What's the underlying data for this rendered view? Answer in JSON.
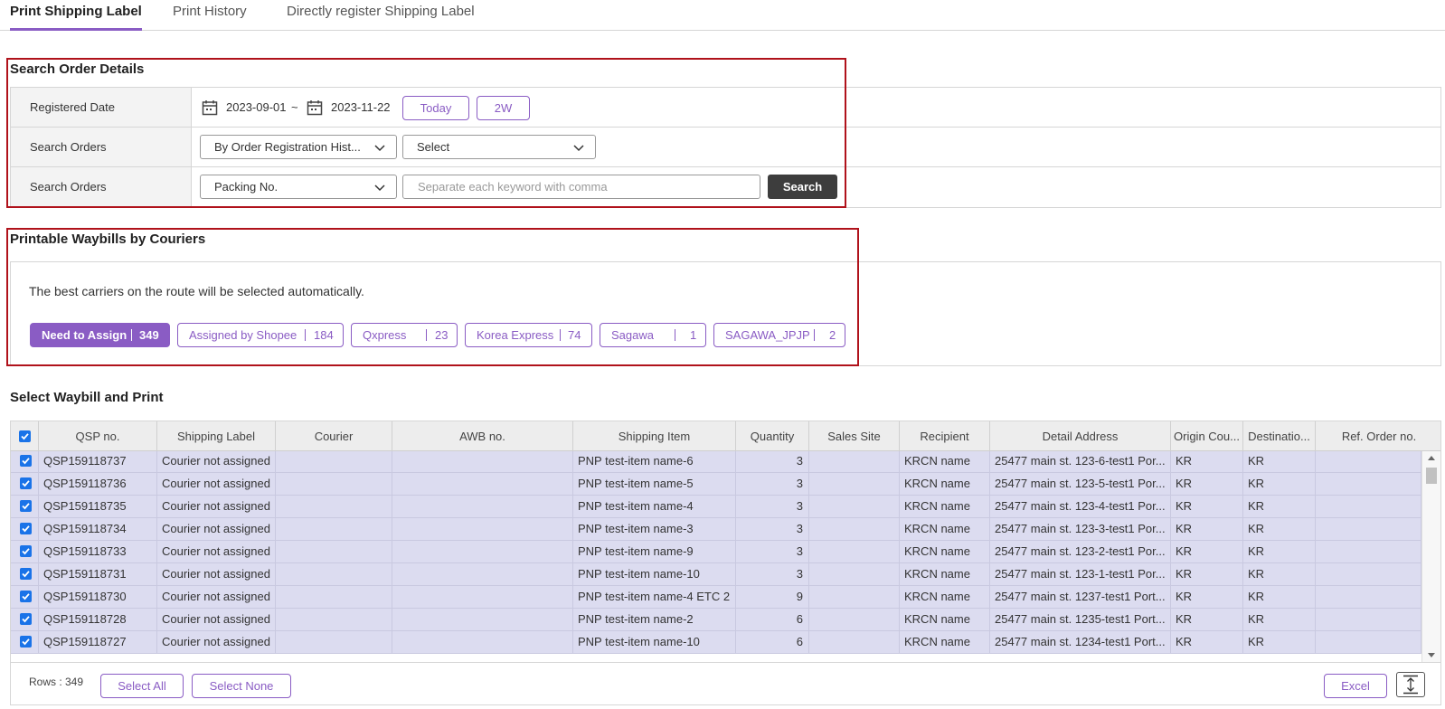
{
  "tabs": [
    {
      "label": "Print Shipping Label",
      "active": true
    },
    {
      "label": "Print History",
      "active": false
    },
    {
      "label": "Directly register Shipping Label",
      "active": false
    }
  ],
  "search": {
    "title": "Search Order Details",
    "registered_date_label": "Registered Date",
    "date_from": "2023-09-01",
    "date_sep": "~",
    "date_to": "2023-11-22",
    "today_button": "Today",
    "two_week_button": "2W",
    "search_orders_label_1": "Search Orders",
    "order_type_select": "By Order Registration Hist...",
    "order_sub_select": "Select",
    "search_orders_label_2": "Search Orders",
    "keyword_type_select": "Packing No.",
    "keyword_placeholder": "Separate each keyword with comma",
    "search_button": "Search"
  },
  "waybills": {
    "title": "Printable Waybills by Couriers",
    "note": "The best carriers on the route will be selected automatically.",
    "chips": [
      {
        "name": "Need to Assign",
        "count": "349",
        "active": true
      },
      {
        "name": "Assigned by Shopee",
        "count": "184",
        "active": false
      },
      {
        "name": "Qxpress",
        "count": "23",
        "active": false
      },
      {
        "name": "Korea Express",
        "count": "74",
        "active": false
      },
      {
        "name": "Sagawa",
        "count": "1",
        "active": false
      },
      {
        "name": "SAGAWA_JPJP",
        "count": "2",
        "active": false
      }
    ]
  },
  "grid": {
    "title": "Select Waybill and Print",
    "columns": [
      "QSP no.",
      "Shipping Label",
      "Courier",
      "AWB no.",
      "Shipping Item",
      "Quantity",
      "Sales Site",
      "Recipient",
      "Detail Address",
      "Origin Cou...",
      "Destinatio...",
      "Ref. Order no."
    ],
    "rows": [
      {
        "qsp": "QSP159118737",
        "label": "Courier not assigned",
        "courier": "",
        "awb": "",
        "item": "PNP test-item name-6",
        "qty": "3",
        "site": "",
        "recipient": "KRCN name",
        "address": "25477 main st. 123-6-test1 Por...",
        "origin": "KR",
        "dest": "KR",
        "ref": ""
      },
      {
        "qsp": "QSP159118736",
        "label": "Courier not assigned",
        "courier": "",
        "awb": "",
        "item": "PNP test-item name-5",
        "qty": "3",
        "site": "",
        "recipient": "KRCN name",
        "address": "25477 main st. 123-5-test1 Por...",
        "origin": "KR",
        "dest": "KR",
        "ref": ""
      },
      {
        "qsp": "QSP159118735",
        "label": "Courier not assigned",
        "courier": "",
        "awb": "",
        "item": "PNP test-item name-4",
        "qty": "3",
        "site": "",
        "recipient": "KRCN name",
        "address": "25477 main st. 123-4-test1 Por...",
        "origin": "KR",
        "dest": "KR",
        "ref": ""
      },
      {
        "qsp": "QSP159118734",
        "label": "Courier not assigned",
        "courier": "",
        "awb": "",
        "item": "PNP test-item name-3",
        "qty": "3",
        "site": "",
        "recipient": "KRCN name",
        "address": "25477 main st. 123-3-test1 Por...",
        "origin": "KR",
        "dest": "KR",
        "ref": ""
      },
      {
        "qsp": "QSP159118733",
        "label": "Courier not assigned",
        "courier": "",
        "awb": "",
        "item": "PNP test-item name-9",
        "qty": "3",
        "site": "",
        "recipient": "KRCN name",
        "address": "25477 main st. 123-2-test1 Por...",
        "origin": "KR",
        "dest": "KR",
        "ref": ""
      },
      {
        "qsp": "QSP159118731",
        "label": "Courier not assigned",
        "courier": "",
        "awb": "",
        "item": "PNP test-item name-10",
        "qty": "3",
        "site": "",
        "recipient": "KRCN name",
        "address": "25477 main st. 123-1-test1 Por...",
        "origin": "KR",
        "dest": "KR",
        "ref": ""
      },
      {
        "qsp": "QSP159118730",
        "label": "Courier not assigned",
        "courier": "",
        "awb": "",
        "item": "PNP test-item name-4 ETC 2",
        "qty": "9",
        "site": "",
        "recipient": "KRCN name",
        "address": "25477 main st. 1237-test1 Port...",
        "origin": "KR",
        "dest": "KR",
        "ref": ""
      },
      {
        "qsp": "QSP159118728",
        "label": "Courier not assigned",
        "courier": "",
        "awb": "",
        "item": "PNP test-item name-2",
        "qty": "6",
        "site": "",
        "recipient": "KRCN name",
        "address": "25477 main st. 1235-test1 Port...",
        "origin": "KR",
        "dest": "KR",
        "ref": ""
      },
      {
        "qsp": "QSP159118727",
        "label": "Courier not assigned",
        "courier": "",
        "awb": "",
        "item": "PNP test-item name-10",
        "qty": "6",
        "site": "",
        "recipient": "KRCN name",
        "address": "25477 main st. 1234-test1 Port...",
        "origin": "KR",
        "dest": "KR",
        "ref": ""
      }
    ],
    "rows_label": "Rows : 349",
    "select_all": "Select All",
    "select_none": "Select None",
    "excel": "Excel"
  },
  "colors": {
    "accent": "#8a5cc4",
    "highlight_box": "#b0121b",
    "row_selected": "#dcdcf0",
    "checkbox": "#1a73e8"
  },
  "icons": [
    "calendar-icon",
    "chevron-down-icon",
    "checkbox-checked-icon",
    "expand-vertical-icon"
  ]
}
